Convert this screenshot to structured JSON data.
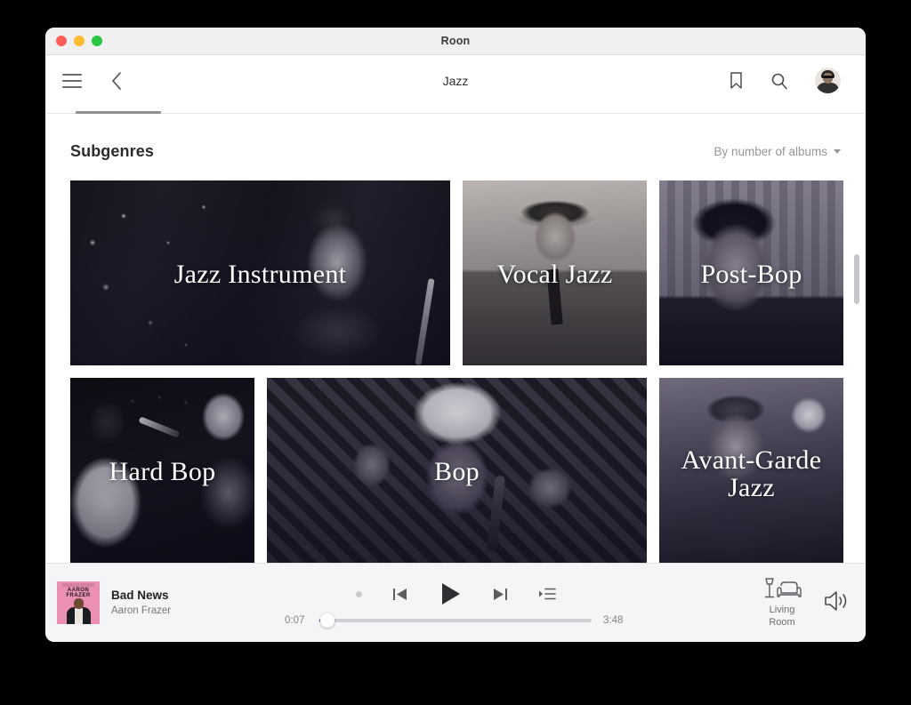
{
  "window": {
    "title": "Roon",
    "traffic_lights": [
      "close",
      "minimize",
      "zoom"
    ]
  },
  "header": {
    "page_title": "Jazz",
    "menu_icon": "hamburger-icon",
    "back_icon": "chevron-left-icon",
    "bookmark_icon": "bookmark-icon",
    "search_icon": "search-icon",
    "avatar_icon": "user-avatar"
  },
  "section": {
    "title": "Subgenres",
    "sort_label": "By number of albums",
    "sort_caret_icon": "chevron-down-icon"
  },
  "tiles": [
    [
      {
        "label": "Jazz Instrument",
        "size": "wide",
        "art": "art-jazzinstrument"
      },
      {
        "label": "Vocal Jazz",
        "size": "narrow",
        "art": "art-vocaljazz"
      },
      {
        "label": "Post-Bop",
        "size": "narrow",
        "art": "art-postbop"
      }
    ],
    [
      {
        "label": "Hard Bop",
        "size": "narrow",
        "art": "art-hardbop"
      },
      {
        "label": "Bop",
        "size": "wide2",
        "art": "art-bop"
      },
      {
        "label": "Avant-Garde Jazz",
        "size": "narrow",
        "art": "art-avantgarde"
      }
    ]
  ],
  "player": {
    "track_title": "Bad News",
    "track_artist": "Aaron Frazer",
    "album_art_text": "AARON FRAZER",
    "elapsed": "0:07",
    "duration": "3:48",
    "progress_percent": 3,
    "loading_indicator_icon": "loading-dot-icon",
    "previous_icon": "skip-previous-icon",
    "play_icon": "play-icon",
    "next_icon": "skip-next-icon",
    "queue_icon": "queue-list-icon",
    "zone_icon": "lamp-armchair-icon",
    "zone_name": "Living\nRoom",
    "zone_name_line1": "Living",
    "zone_name_line2": "Room",
    "volume_icon": "speaker-volume-icon"
  },
  "colors": {
    "accent": "#5b5be0",
    "window_bg": "#ffffff",
    "player_bg": "#f4f5f7",
    "titlebar_bg": "#f0f0f0",
    "backdrop": "#000000"
  }
}
